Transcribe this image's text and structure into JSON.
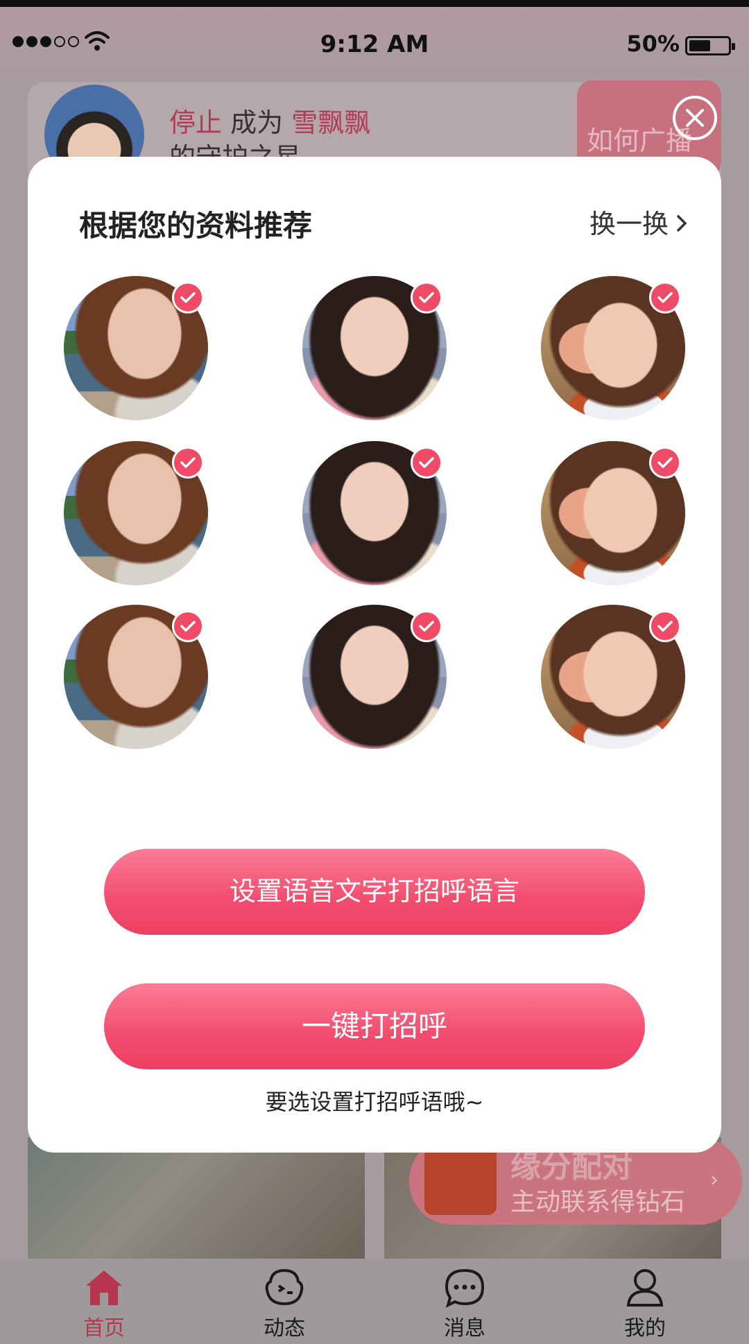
{
  "status_bar": {
    "time": "9:12 AM",
    "battery_percent": "50%",
    "battery_level": 0.5,
    "signal_bars_filled": 3,
    "signal_bars_total": 5
  },
  "background": {
    "banner": {
      "word_stop": "停止",
      "word_become": "成为",
      "name": "雪飘飘",
      "line2": "的守护之星",
      "ad_button": "如何广播"
    },
    "match_badge": {
      "title": "缘分配对",
      "subtitle": "主动联系得钻石"
    }
  },
  "modal": {
    "title": "根据您的资料推荐",
    "refresh_label": "换一换",
    "avatars": [
      {
        "checked": true
      },
      {
        "checked": true
      },
      {
        "checked": true
      },
      {
        "checked": true
      },
      {
        "checked": true
      },
      {
        "checked": true
      },
      {
        "checked": true
      },
      {
        "checked": true
      },
      {
        "checked": true
      }
    ],
    "voice_button": "设置语音文字打招呼语言",
    "greet_button": "一键打招呼",
    "hint": "要选设置打招呼语哦~"
  },
  "tabbar": {
    "tabs": [
      {
        "label": "首页",
        "active": true
      },
      {
        "label": "动态",
        "active": false
      },
      {
        "label": "消息",
        "active": false
      },
      {
        "label": "我的",
        "active": false
      }
    ]
  },
  "colors": {
    "accent": "#f24c6e",
    "check": "#ef4a66",
    "tab_active": "#b7354e"
  }
}
